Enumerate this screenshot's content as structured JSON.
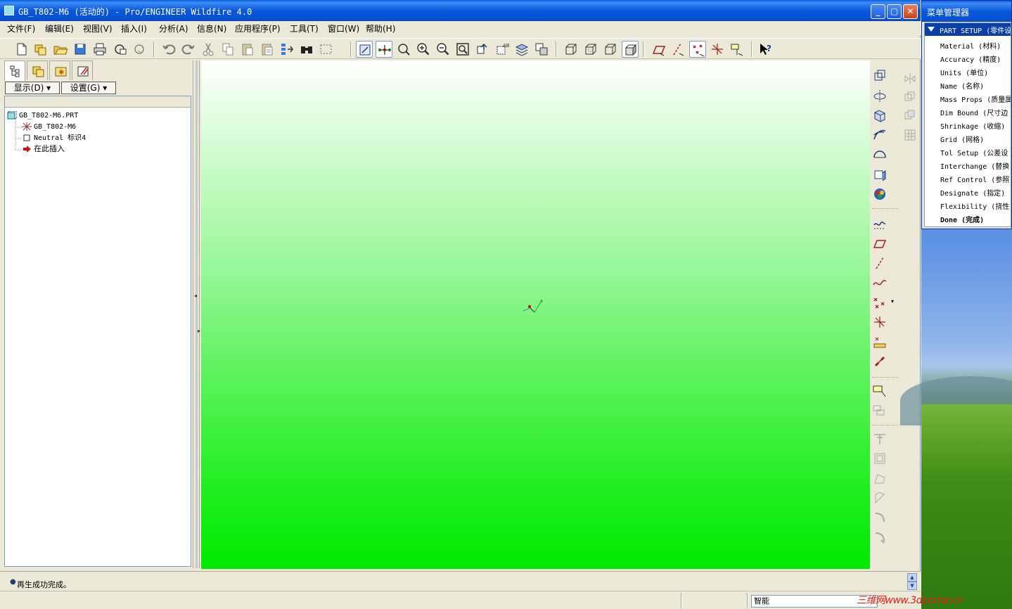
{
  "window": {
    "title": "GB_T802-M6 (活动的) - Pro/ENGINEER Wildfire 4.0"
  },
  "menu": [
    {
      "label": "文件(F)"
    },
    {
      "label": "编辑(E)"
    },
    {
      "label": "视图(V)"
    },
    {
      "label": "插入(I)"
    },
    {
      "label": "分析(A)"
    },
    {
      "label": "信息(N)"
    },
    {
      "label": "应用程序(P)"
    },
    {
      "label": "工具(T)"
    },
    {
      "label": "窗口(W)"
    },
    {
      "label": "帮助(H)"
    }
  ],
  "navigator": {
    "show_button": "显示(D) ▾",
    "settings_button": "设置(G) ▾",
    "tree": [
      {
        "label": "GB_T802-M6.PRT",
        "icon": "part-icon"
      },
      {
        "label": "GB_T802-M6",
        "icon": "coordinate-system-icon"
      },
      {
        "label": "Neutral 标识4",
        "icon": "neutral-feature-icon"
      },
      {
        "label": "在此插入",
        "icon": "insert-here-arrow-icon"
      }
    ]
  },
  "menu_manager": {
    "title": "菜单管理器",
    "header": "PART SETUP (零件设",
    "items": [
      "Material (材料)",
      "Accuracy (精度)",
      "Units (单位)",
      "Name (名称)",
      "Mass Props (质量属",
      "Dim Bound (尺寸边",
      "Shrinkage (收缩)",
      "Grid (网格)",
      "Tol Setup (公差设",
      "Interchange (替换",
      "Ref Control (参照",
      "Designate (指定)",
      "Flexibility (挠性"
    ],
    "done": "Done (完成)"
  },
  "status": {
    "message": "再生成功完成。",
    "filter": "智能"
  },
  "watermark": "三维网www.3dportal.cn",
  "colors": {
    "titlebar": "#0858dc",
    "canvas_top": "#ffffff",
    "canvas_bottom": "#00ea00"
  }
}
